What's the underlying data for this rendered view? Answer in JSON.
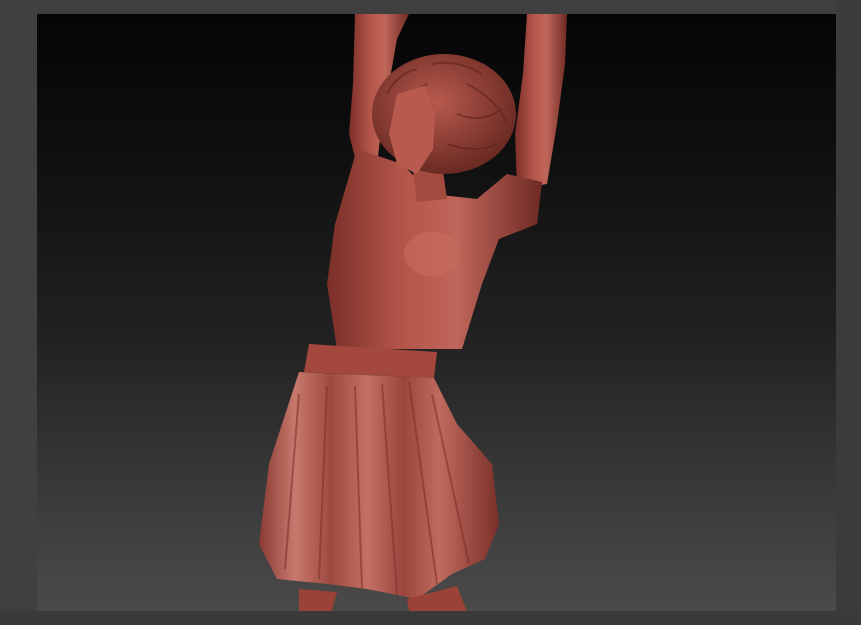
{
  "app": {
    "name": "",
    "viewport_content": "sculpt-model",
    "material_color": "#b4554a",
    "background_top": "#050505",
    "background_bottom": "#4a4a4a"
  }
}
